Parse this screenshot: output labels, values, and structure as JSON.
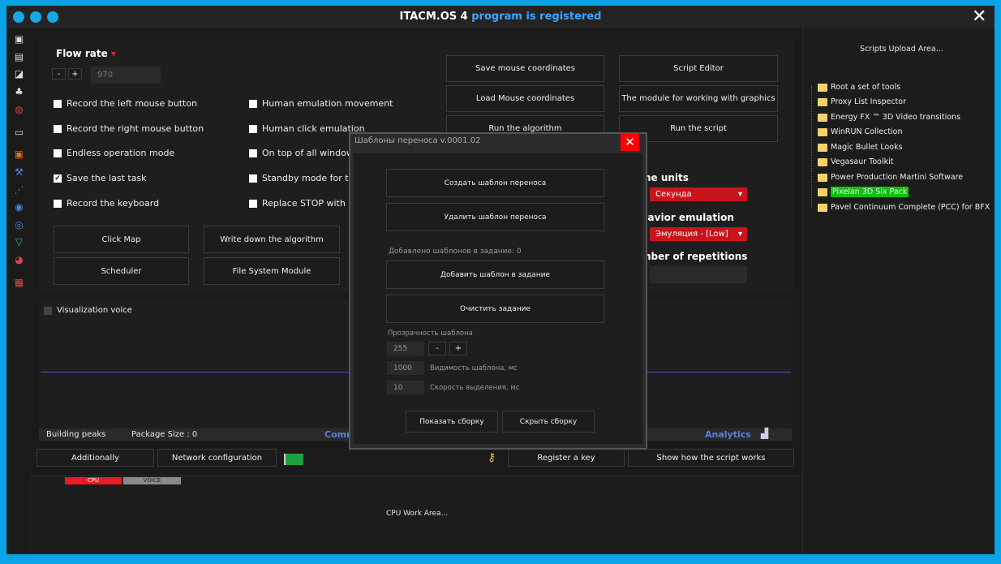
{
  "window": {
    "title": "ITACM.OS 4",
    "registered": "program is registered"
  },
  "sidebar_icons": [
    "camera-icon",
    "printer-icon",
    "images-icon",
    "shapes-icon",
    "globe-icon",
    "archive-icon",
    "crop-icon",
    "wrench-icon",
    "nodes-icon",
    "target-icon",
    "orbit-icon",
    "vector-icon",
    "pie-icon",
    "checker-icon"
  ],
  "flow": {
    "label": "Flow rate",
    "minus": "-",
    "plus": "+",
    "value": "970"
  },
  "checkboxes_left": [
    {
      "label": "Record the left mouse button",
      "checked": false
    },
    {
      "label": "Record the right mouse button",
      "checked": false
    },
    {
      "label": "Endless operation mode",
      "checked": false
    },
    {
      "label": "Save the last task",
      "checked": true
    },
    {
      "label": "Record the keyboard",
      "checked": false
    }
  ],
  "checkboxes_right": [
    {
      "label": "Human emulation movement",
      "checked": false
    },
    {
      "label": "Human click emulation",
      "checked": false
    },
    {
      "label": "On top of all windows",
      "checked": false
    },
    {
      "label": "Standby mode for the",
      "checked": false
    },
    {
      "label": "Replace STOP with PA",
      "checked": false
    }
  ],
  "buttons": {
    "click_map": "Click Map",
    "write_algorithm": "Write down the algorithm",
    "scheduler": "Scheduler",
    "file_system": "File System Module",
    "save_mouse": "Save mouse coordinates",
    "load_mouse": "Load Mouse coordinates",
    "run_algorithm": "Run the algorithm",
    "script_editor": "Script Editor",
    "graphics_module": "The module for working with graphics",
    "run_script": "Run the script",
    "additionally": "Additionally",
    "network": "Network configuration",
    "register_key": "Register a key",
    "show_script": "Show how the script works"
  },
  "settings": {
    "time_units_label": "me units",
    "time_units_value": "Секунда",
    "behavior_label": "havior emulation",
    "behavior_value": "Эмуляция - [Low]",
    "repetitions_label": "mber of repetitions",
    "repetitions_value": ""
  },
  "viz": {
    "voice_label": "Visualization voice",
    "building_peaks": "Building peaks",
    "package_size": "Package Size : 0",
    "comm": "Comm",
    "analytics": "Analytics"
  },
  "cpu": {
    "cpu_tab": "CPU",
    "voice_tab": "VOICE",
    "area": "CPU Work Area..."
  },
  "right": {
    "upload": "Scripts Upload Area...",
    "tree": [
      "Root a set of tools",
      "Proxy List Inspector",
      "Energy FX ™ 3D Video transitions",
      "WinRUN Collection",
      "Magic Bullet Looks",
      "Vegasaur Toolkit",
      "Power Production Martini Software",
      "Pixelan 3D Six Pack",
      "Pavel Continuum Complete (PCC) for BFX"
    ],
    "selected_index": 7
  },
  "dialog": {
    "title": "Шаблоны переноса v.0001.02",
    "create": "Создать шаблон переноса",
    "delete": "Удалить шаблон переноса",
    "added": "Добавлено шаблонов в задание: 0",
    "add": "Добавить шаблон в задание",
    "clear": "Очистить задание",
    "opacity_label": "Прозрачность шаблона",
    "opacity_value": "255",
    "minus": "-",
    "plus": "+",
    "visibility_value": "1000",
    "visibility_label": "Видимость шаблона, мс",
    "speed_value": "10",
    "speed_label": "Скорость выделения, мс",
    "show": "Показать сборку",
    "hide": "Скрыть сборку"
  },
  "colors": {
    "accent": "#0aa3e8",
    "red": "#c8141b",
    "selected": "#10c010",
    "link": "#5b7fe0"
  }
}
